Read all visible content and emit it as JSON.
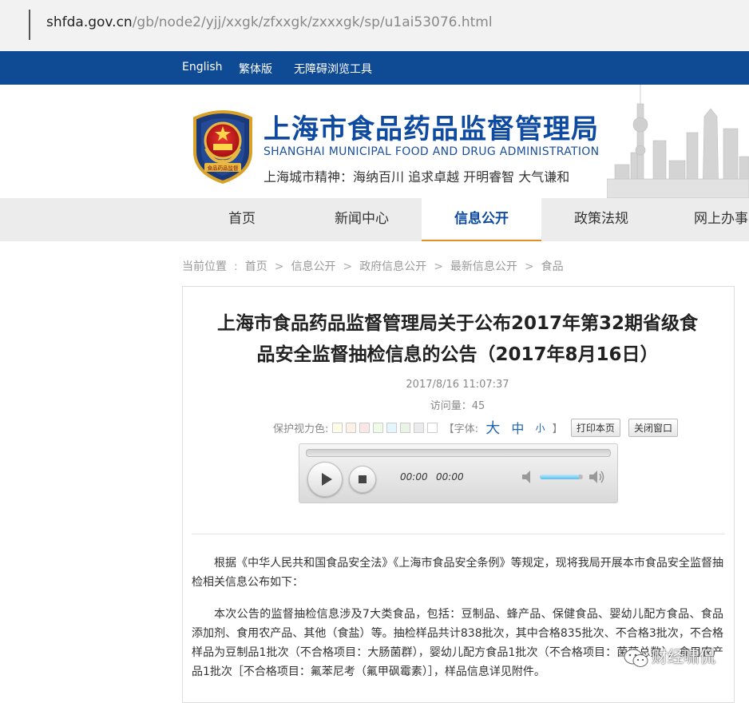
{
  "address_bar": {
    "host": "shfda.gov.cn",
    "path": "/gb/node2/yjj/xxgk/zfxxgk/zxxxgk/sp/u1ai53076.html"
  },
  "top_links": [
    "English",
    "繁体版",
    "无障碍浏览工具"
  ],
  "header": {
    "title": "上海市食品药品监督管理局",
    "title_en": "SHANGHAI MUNICIPAL FOOD AND DRUG ADMINISTRATION",
    "slogan": "上海城市精神：海纳百川  追求卓越  开明睿智  大气谦和",
    "emblem_text": "食品药品监督"
  },
  "nav": {
    "items": [
      "首页",
      "新闻中心",
      "信息公开",
      "政策法规",
      "网上办事"
    ],
    "active": "信息公开",
    "accent_color": "#e0912b"
  },
  "breadcrumb": {
    "label": "当前位置",
    "items": [
      "首页",
      "信息公开",
      "政府信息公开",
      "最新信息公开",
      "食品"
    ]
  },
  "article": {
    "title_line1": "上海市食品药品监督管理局关于公布2017年第32期省级食",
    "title_line2": "品安全监督抽检信息的公告（2017年8月16日）",
    "datetime": "2017/8/16 11:07:37",
    "visits": "访问量：45",
    "eye_care_label": "保护视力色:",
    "eye_care_colors": [
      "#fdfde8",
      "#fdf0e4",
      "#fde6e6",
      "#eefbe6",
      "#e3f6fb",
      "#e8f5e4",
      "#ebebeb",
      "#ffffff"
    ],
    "font_label": "【字体:",
    "font_large": "大",
    "font_medium": "中",
    "font_small": "小",
    "font_close": "】",
    "print_button": "打印本页",
    "close_button": "关闭窗口",
    "paragraph1": "根据《中华人民共和国食品安全法》《上海市食品安全条例》等规定，现将我局开展本市食品安全监督抽检相关信息公布如下：",
    "paragraph2": "本次公告的监督抽检信息涉及7大类食品，包括：豆制品、蜂产品、保健食品、婴幼儿配方食品、食品添加剂、食用农产品、其他（食盐）等。抽检样品共计838批次，其中合格835批次、不合格3批次，不合格样品为豆制品1批次（不合格项目：大肠菌群），婴幼儿配方食品1批次（不合格项目：菌落总数），食用农产品1批次［不合格项目：氟苯尼考（氟甲砜霉素）］，样品信息详见附件。"
  },
  "player": {
    "current_time": "00:00",
    "total_time": "00:00",
    "volume": 0.9
  },
  "watermark": "财经啸侃"
}
